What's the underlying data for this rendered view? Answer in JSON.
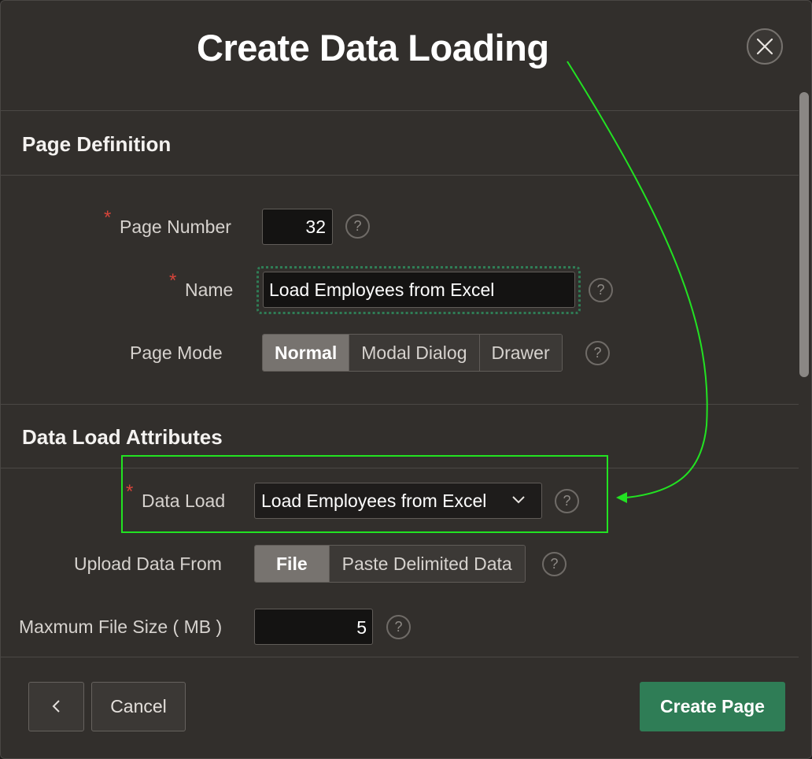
{
  "dialog": {
    "title": "Create Data Loading",
    "close_icon": "close-icon"
  },
  "page_definition": {
    "section_title": "Page Definition",
    "page_number_label": "Page Number",
    "page_number_value": "32",
    "name_label": "Name",
    "name_value": "Load Employees from Excel",
    "page_mode_label": "Page Mode",
    "page_mode_options": [
      "Normal",
      "Modal Dialog",
      "Drawer"
    ],
    "page_mode_selected": "Normal"
  },
  "data_load_attributes": {
    "section_title": "Data Load Attributes",
    "data_load_label": "Data Load",
    "data_load_value": "Load Employees from Excel",
    "upload_from_label": "Upload Data From",
    "upload_from_options": [
      "File",
      "Paste Delimited Data"
    ],
    "upload_from_selected": "File",
    "max_file_size_label": "Maxmum File Size ( MB )",
    "max_file_size_value": "5"
  },
  "help_glyph": "?",
  "required_marker": "*",
  "footer": {
    "back_icon": "chevron-left-icon",
    "cancel_label": "Cancel",
    "create_label": "Create Page"
  },
  "colors": {
    "dialog_bg": "#322f2c",
    "input_bg": "#141312",
    "required": "#d6443a",
    "primary": "#2f7d56",
    "annotation": "#22e222"
  }
}
